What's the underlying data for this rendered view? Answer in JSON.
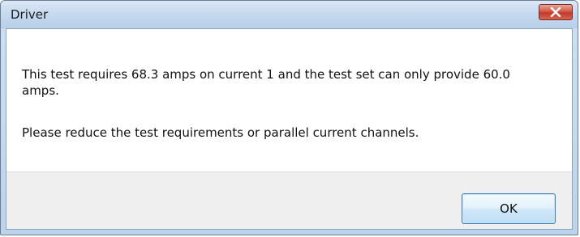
{
  "window": {
    "title": "Driver",
    "close_icon": "close-icon",
    "close_color": "#c4392a"
  },
  "dialog": {
    "message_line1": "This test requires 68.3 amps on current 1 and the test set can only provide 60.0 amps.",
    "message_line2": "Please reduce the test requirements or parallel current channels.",
    "ok_label": "OK"
  }
}
